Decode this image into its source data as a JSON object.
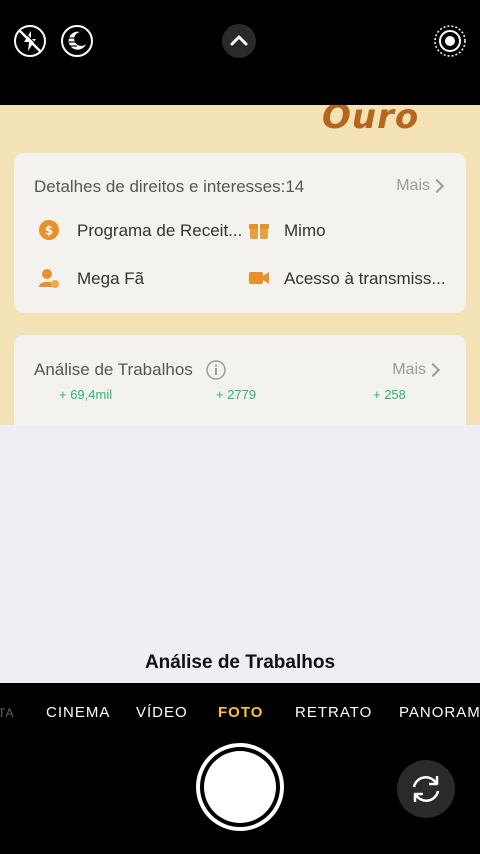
{
  "camera": {
    "top_icons": [
      "flash-off-icon",
      "night-mode-icon",
      "chevron-up-icon",
      "live-photo-icon"
    ],
    "modes": [
      "TA",
      "CINEMA",
      "VÍDEO",
      "FOTO",
      "RETRATO",
      "PANORAMA"
    ],
    "active_mode": "FOTO",
    "active_color": "#f7c52c",
    "caption": "Análise de Trabalhos"
  },
  "viewfinder": {
    "header_text": "Ouro",
    "rights_card": {
      "title": "Detalhes de direitos e interesses:14",
      "more": "Mais",
      "items": [
        {
          "label": "Programa de Receit...",
          "icon": "coin-icon"
        },
        {
          "label": "Mimo",
          "icon": "gift-icon"
        },
        {
          "label": "Mega Fã",
          "icon": "user-heart-icon"
        },
        {
          "label": "Acesso à transmiss...",
          "icon": "video-camera-icon"
        }
      ]
    },
    "works_card": {
      "title": "Análise de Trabalhos",
      "more": "Mais",
      "stats": [
        "+ 69,4mil",
        "+ 2779",
        "+ 258"
      ]
    }
  }
}
